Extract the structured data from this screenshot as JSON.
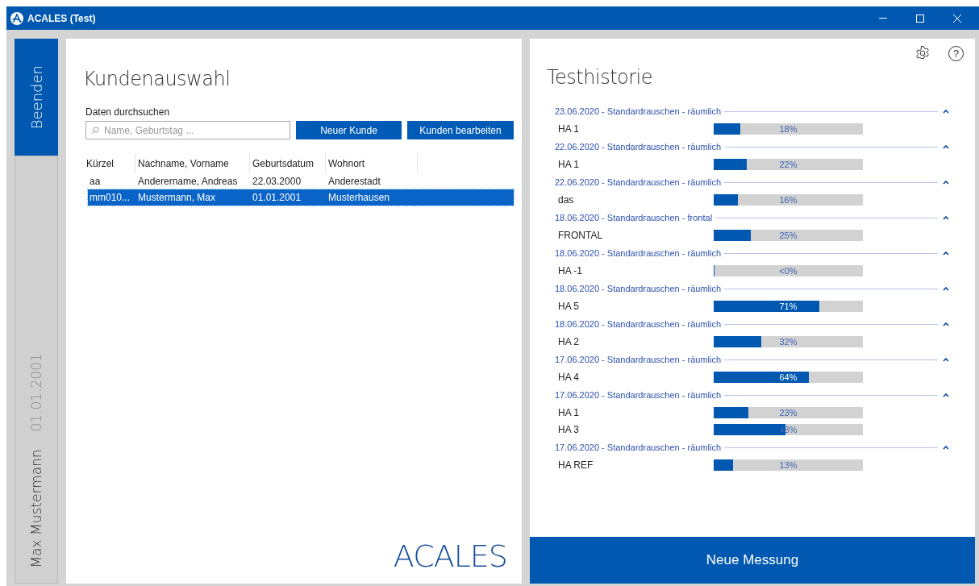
{
  "window": {
    "title": "ACALES (Test)"
  },
  "sidebar": {
    "exit_button": "Beenden",
    "customer_tab": {
      "name": "Max Mustermann",
      "birthdate": "01.01.2001"
    }
  },
  "customer_panel": {
    "title": "Kundenauswahl",
    "search_label": "Daten durchsuchen",
    "search": {
      "placeholder": "Name, Geburtstag ..."
    },
    "buttons": [
      "Neuer Kunde",
      "Kunden bearbeiten"
    ],
    "table": {
      "columns": [
        "Kürzel",
        "Nachname, Vorname",
        "Geburtsdatum",
        "Wohnort"
      ],
      "rows": [
        {
          "cells": [
            "aa",
            "Anderername, Andreas",
            "22.03.2000",
            "Anderestadt"
          ],
          "selected": false
        },
        {
          "cells": [
            "mm010...",
            "Mustermann, Max",
            "01.01.2001",
            "Musterhausen"
          ],
          "selected": true
        }
      ]
    },
    "logo": "ACALES"
  },
  "history_panel": {
    "help_button": "?",
    "title": "Testhistorie",
    "groups": [
      {
        "header": "23.06.2020 - Standardrauschen - räumlich",
        "expanded": true,
        "items": [
          {
            "label": "HA 1",
            "level": 0.18,
            "reading": "18%"
          }
        ]
      },
      {
        "header": "22.06.2020 - Standardrauschen - räumlich",
        "expanded": true,
        "items": [
          {
            "label": "HA 1",
            "level": 0.22,
            "reading": "22%"
          }
        ]
      },
      {
        "header": "22.06.2020 - Standardrauschen - räumlich",
        "expanded": true,
        "items": [
          {
            "label": "das",
            "level": 0.16,
            "reading": "16%"
          }
        ]
      },
      {
        "header": "18.06.2020 - Standardrauschen - frontal",
        "expanded": true,
        "items": [
          {
            "label": "FRONTAL",
            "level": 0.25,
            "reading": "25%"
          }
        ]
      },
      {
        "header": "18.06.2020 - Standardrauschen - räumlich",
        "expanded": true,
        "items": [
          {
            "label": "HA -1",
            "level": 0,
            "reading": "<0%"
          }
        ]
      },
      {
        "header": "18.06.2020 - Standardrauschen - räumlich",
        "expanded": true,
        "items": [
          {
            "label": "HA 5",
            "level": 0.71,
            "reading": "71%"
          }
        ]
      },
      {
        "header": "18.06.2020 - Standardrauschen - räumlich",
        "expanded": true,
        "items": [
          {
            "label": "HA 2",
            "level": 0.32,
            "reading": "32%"
          }
        ]
      },
      {
        "header": "17.06.2020 - Standardrauschen - räumlich",
        "expanded": true,
        "items": [
          {
            "label": "HA 4",
            "level": 0.64,
            "reading": "64%"
          }
        ]
      },
      {
        "header": "17.06.2020 - Standardrauschen - räumlich",
        "expanded": true,
        "items": [
          {
            "label": "HA 1",
            "level": 0.23,
            "reading": "23%"
          },
          {
            "label": "HA 3",
            "level": 0.48,
            "reading": "48%"
          }
        ]
      },
      {
        "header": "17.06.2020 - Standardrauschen - räumlich",
        "expanded": true,
        "items": [
          {
            "label": "HA REF",
            "level": 0.13,
            "reading": "13%"
          }
        ]
      }
    ],
    "new_measurement_button": "Neue Messung"
  }
}
